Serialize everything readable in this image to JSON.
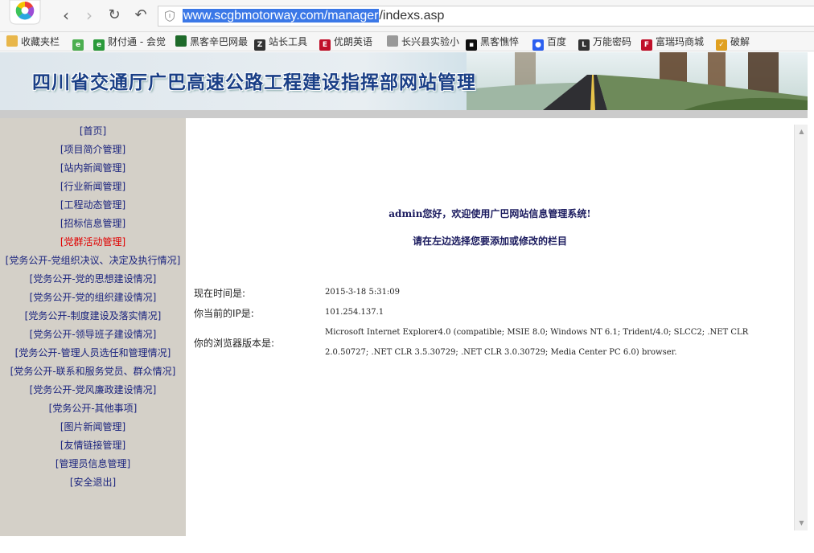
{
  "browser": {
    "url_highlight": "www.scgbmotorway.com/manager",
    "url_rest": "/indexs.asp",
    "icons": {
      "back": "back-icon",
      "forward": "forward-icon",
      "reload": "reload-icon",
      "undo": "undo-icon",
      "security": "shield-icon"
    },
    "bookmarks": [
      {
        "label": "收藏夹栏",
        "icon": "folder-icon",
        "color": "#e8b64a"
      },
      {
        "label": "财付通 - 会觉",
        "icon": "caifutong-icon",
        "color": "#2a9a3a"
      },
      {
        "label": "黑客辛巴网最",
        "icon": "tree-icon",
        "color": "#1e6a2a"
      },
      {
        "label": "站长工具",
        "icon": "zhanzhang-icon",
        "color": "#333333"
      },
      {
        "label": "优朗英语",
        "icon": "youlang-icon",
        "color": "#c0102a"
      },
      {
        "label": "长兴县实验小",
        "icon": "page-icon",
        "color": "#999999"
      },
      {
        "label": "黑客憔悴",
        "icon": "heike-icon",
        "color": "#111111"
      },
      {
        "label": "百度",
        "icon": "baidu-icon",
        "color": "#2b5ff0"
      },
      {
        "label": "万能密码",
        "icon": "letter-l-icon",
        "color": "#333333"
      },
      {
        "label": "富瑞玛商城",
        "icon": "frm-icon",
        "color": "#c0102a"
      },
      {
        "label": "破解",
        "icon": "check-icon",
        "color": "#e0a020"
      }
    ]
  },
  "banner": {
    "title": "四川省交通厅广巴高速公路工程建设指挥部网站管理"
  },
  "sidebar": {
    "items": [
      {
        "label": "[首页]",
        "active": false
      },
      {
        "label": "[项目简介管理]",
        "active": false
      },
      {
        "label": "[站内新闻管理]",
        "active": false
      },
      {
        "label": "[行业新闻管理]",
        "active": false
      },
      {
        "label": "[工程动态管理]",
        "active": false
      },
      {
        "label": "[招标信息管理]",
        "active": false
      },
      {
        "label": "[党群活动管理]",
        "active": true
      },
      {
        "label": "[党务公开-党组织决议、决定及执行情况]",
        "active": false
      },
      {
        "label": "[党务公开-党的思想建设情况]",
        "active": false
      },
      {
        "label": "[党务公开-党的组织建设情况]",
        "active": false
      },
      {
        "label": "[党务公开-制度建设及落实情况]",
        "active": false
      },
      {
        "label": "[党务公开-领导班子建设情况]",
        "active": false
      },
      {
        "label": "[党务公开-管理人员选任和管理情况]",
        "active": false
      },
      {
        "label": "[党务公开-联系和服务党员、群众情况]",
        "active": false
      },
      {
        "label": "[党务公开-党风廉政建设情况]",
        "active": false
      },
      {
        "label": "[党务公开-其他事项]",
        "active": false
      },
      {
        "label": "[图片新闻管理]",
        "active": false
      },
      {
        "label": "[友情链接管理]",
        "active": false
      },
      {
        "label": "[管理员信息管理]",
        "active": false
      },
      {
        "label": "[安全退出]",
        "active": false
      }
    ]
  },
  "main": {
    "welcome": "admin您好，欢迎使用广巴网站信息管理系统!",
    "hint": "请在左边选择您要添加或修改的栏目",
    "time_label": "现在时间是:",
    "time_value": "2015-3-18 5:31:09",
    "ip_label": "你当前的IP是:",
    "ip_value": "101.254.137.1",
    "ua_label": "你的浏览器版本是:",
    "ua_value": "Microsoft Internet Explorer4.0 (compatible; MSIE 8.0; Windows NT 6.1; Trident/4.0; SLCC2; .NET CLR 2.0.50727; .NET CLR 3.5.30729; .NET CLR 3.0.30729; Media Center PC 6.0) browser."
  },
  "colors": {
    "sidebar_bg": "#d4d0c8",
    "menu_link": "#1a237e",
    "menu_active": "#e00000",
    "title_blue": "#1a3f86",
    "url_highlight": "#3b78e7"
  }
}
